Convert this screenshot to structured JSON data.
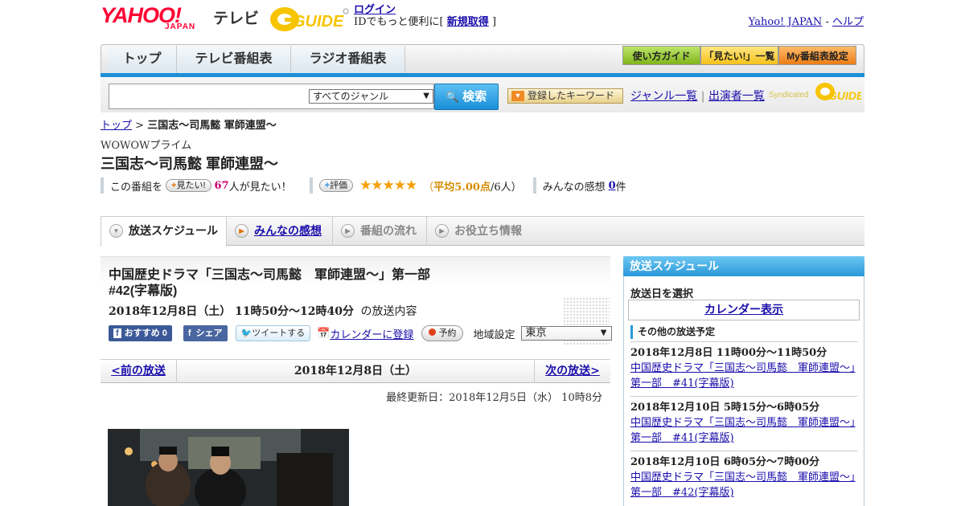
{
  "header": {
    "logo_yahoo": "YAHOO!",
    "logo_japan": "JAPAN",
    "logo_tv": "テレビ",
    "gguide_logo": "G-GUIDE",
    "login_label": "ログイン",
    "login_prompt_before": "IDでもっと便利に[",
    "signup_label": "新規取得",
    "login_prompt_after": "]",
    "yahoo_japan_link": "Yahoo! JAPAN",
    "separator": "-",
    "help_link": "ヘルプ"
  },
  "nav": {
    "tabs": [
      "トップ",
      "テレビ番組表",
      "ラジオ番組表"
    ],
    "guide_button": "使い方ガイド",
    "mitai_button": "「見たい!」一覧",
    "my_button": "My番組表設定"
  },
  "search": {
    "input_value": "",
    "genre_selected": "すべてのジャンル",
    "search_button": "検索",
    "keyword_button": "登録したキーワード",
    "genre_list_link": "ジャンル一覧",
    "divider": "|",
    "performer_list_link": "出演者一覧",
    "syndicated_label": "Syndicated"
  },
  "breadcrumb": {
    "top": "トップ",
    "separator": ">",
    "current": "三国志～司馬懿 軍師連盟～"
  },
  "program": {
    "channel": "WOWOWプライム",
    "title": "三国志～司馬懿 軍師連盟～",
    "this_program": "この番組を",
    "mitai_btn": "見たい!",
    "mitai_count": "67",
    "mitai_suffix": "人が見たい！",
    "rate_btn": "評価",
    "stars": "★★★★★",
    "avg_prefix": "（",
    "avg_label": "平均5.00点",
    "avg_suffix": "/6人）",
    "impressions_label": "みんなの感想",
    "impressions_count": "0",
    "impressions_unit": "件"
  },
  "tabs": {
    "schedule": "放送スケジュール",
    "impressions": "みんなの感想",
    "flow": "番組の流れ",
    "info": "お役立ち情報"
  },
  "episode": {
    "title_line1": "中国歴史ドラマ「三国志～司馬懿　軍師連盟～」第一部",
    "title_line2": "#42(字幕版)",
    "datetime": "2018年12月8日（土）  11時50分～12時40分",
    "datetime_suffix": "の放送内容",
    "fb_recommend": "おすすめ 0",
    "fb_share": "シェア",
    "tweet": "ツイートする",
    "calendar_register": "カレンダーに登録",
    "reserve": "予約",
    "region_label": "地域設定",
    "region_value": "東京",
    "prev": "<前の放送",
    "current_date": "2018年12月8日（土）",
    "next": "次の放送>",
    "updated": "最終更新日：2018年12月5日（水）  10時8分"
  },
  "sidebar": {
    "header": "放送スケジュール",
    "select_date": "放送日を選択",
    "calendar_btn": "カレンダー表示",
    "other_header": "その他の放送予定",
    "items": [
      {
        "time": "2018年12月8日  11時00分～11時50分",
        "title": "中国歴史ドラマ「三国志～司馬懿　軍師連盟～」第一部　#41(字幕版)"
      },
      {
        "time": "2018年12月10日  5時15分～6時05分",
        "title": "中国歴史ドラマ「三国志～司馬懿　軍師連盟～」第一部　#41(字幕版)"
      },
      {
        "time": "2018年12月10日  6時05分～7時00分",
        "title": "中国歴史ドラマ「三国志～司馬懿　軍師連盟～」第一部　#42(字幕版)"
      }
    ]
  },
  "colors": {
    "accent_blue": "#1c8fd6",
    "yahoo_red": "#ff0033",
    "star_gold": "#f5a000",
    "guide_green": "#8ec31f",
    "mitai_yellow": "#ffcc33",
    "my_orange": "#f08a24"
  }
}
